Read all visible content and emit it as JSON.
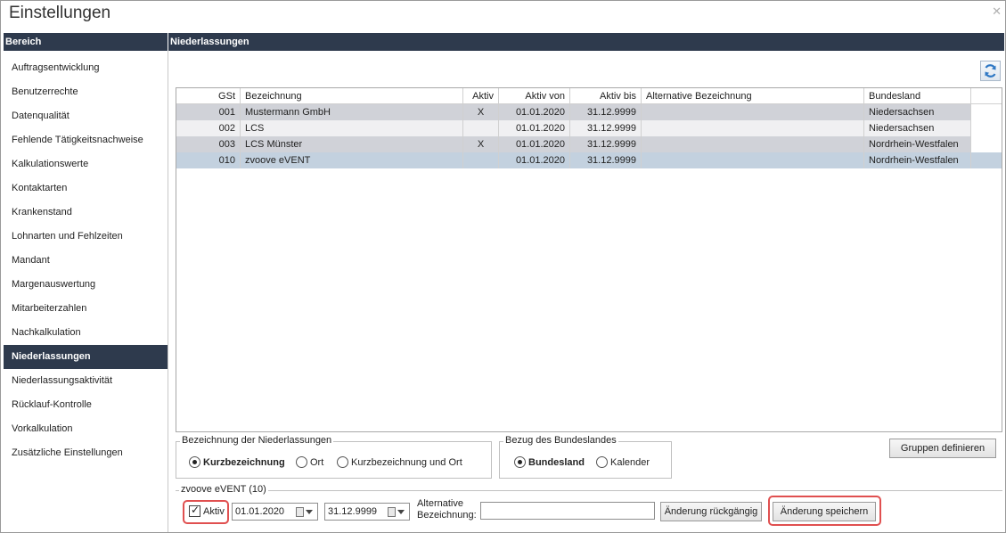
{
  "window": {
    "title": "Einstellungen",
    "close_label": "✕"
  },
  "sidebar": {
    "header": "Bereich",
    "items": [
      {
        "label": "Auftragsentwicklung"
      },
      {
        "label": "Benutzerrechte"
      },
      {
        "label": "Datenqualität"
      },
      {
        "label": "Fehlende Tätigkeitsnachweise"
      },
      {
        "label": "Kalkulationswerte"
      },
      {
        "label": "Kontaktarten"
      },
      {
        "label": "Krankenstand"
      },
      {
        "label": "Lohnarten und Fehlzeiten"
      },
      {
        "label": "Mandant"
      },
      {
        "label": "Margenauswertung"
      },
      {
        "label": "Mitarbeiterzahlen"
      },
      {
        "label": "Nachkalkulation"
      },
      {
        "label": "Niederlassungen",
        "active": true
      },
      {
        "label": "Niederlassungsaktivität"
      },
      {
        "label": "Rücklauf-Kontrolle"
      },
      {
        "label": "Vorkalkulation"
      },
      {
        "label": "Zusätzliche Einstellungen"
      }
    ]
  },
  "main": {
    "header": "Niederlassungen",
    "grid": {
      "columns": [
        "GSt",
        "Bezeichnung",
        "Aktiv",
        "Aktiv von",
        "Aktiv bis",
        "Alternative Bezeichnung",
        "Bundesland"
      ],
      "rows": [
        [
          "001",
          "Mustermann GmbH",
          "X",
          "01.01.2020",
          "31.12.9999",
          "",
          "Niedersachsen"
        ],
        [
          "002",
          "LCS",
          "",
          "01.01.2020",
          "31.12.9999",
          "",
          "Niedersachsen"
        ],
        [
          "003",
          "LCS Münster",
          "X",
          "01.01.2020",
          "31.12.9999",
          "",
          "Nordrhein-Westfalen"
        ],
        [
          "010",
          "zvoove eVENT",
          "",
          "01.01.2020",
          "31.12.9999",
          "",
          "Nordrhein-Westfalen"
        ]
      ]
    },
    "naming_group": {
      "legend": "Bezeichnung der Niederlassungen",
      "options": [
        "Kurzbezeichnung",
        "Ort",
        "Kurzbezeichnung und Ort"
      ],
      "selected": "Kurzbezeichnung"
    },
    "state_group": {
      "legend": "Bezug des Bundeslandes",
      "options": [
        "Bundesland",
        "Kalender"
      ],
      "selected": "Bundesland"
    },
    "groups_button": "Gruppen definieren",
    "edit": {
      "legend": "zvoove eVENT (10)",
      "active_label": "Aktiv",
      "active_checked": true,
      "from_date": "01.01.2020",
      "to_date": "31.12.9999",
      "alt_label_1": "Alternative",
      "alt_label_2": "Bezeichnung:",
      "alt_value": "",
      "undo_button": "Änderung rückgängig",
      "save_button": "Änderung speichern"
    },
    "highlight_color": "#e05050"
  }
}
